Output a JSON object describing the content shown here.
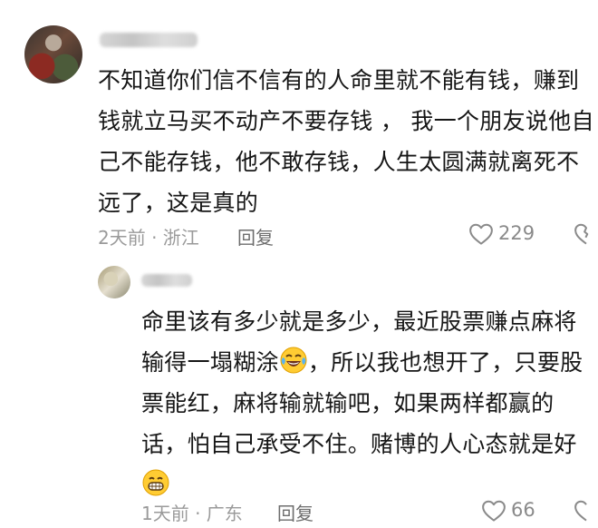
{
  "comment": {
    "text_lines": [
      "不知道你们信不信有的人命里就不能有钱，赚到",
      "钱就立马买不动产不要存钱 ， 我一个朋友说他自",
      "己不能存钱，他不敢存钱，人生太圆满就离死不",
      "远了，这是真的"
    ],
    "meta": "2天前 · 浙江",
    "reply_label": "回复",
    "likes": "229"
  },
  "reply": {
    "line1": "命里该有多少就是多少，最近股票赚点麻将",
    "line2_before": "输得一塌糊涂",
    "line2_after": "，所以我也想开了，只要股",
    "line3": "票能红，麻将输就输吧，如果两样都赢的",
    "line4": "话，怕自己承受不住。赌博的人心态就是好",
    "meta": "1天前 · 广东",
    "reply_label": "回复",
    "likes": "66"
  },
  "icons": {
    "like": "heart-outline-icon",
    "laugh_cry": "face-with-tears-of-joy-emoji",
    "grin": "grinning-face-emoji"
  }
}
